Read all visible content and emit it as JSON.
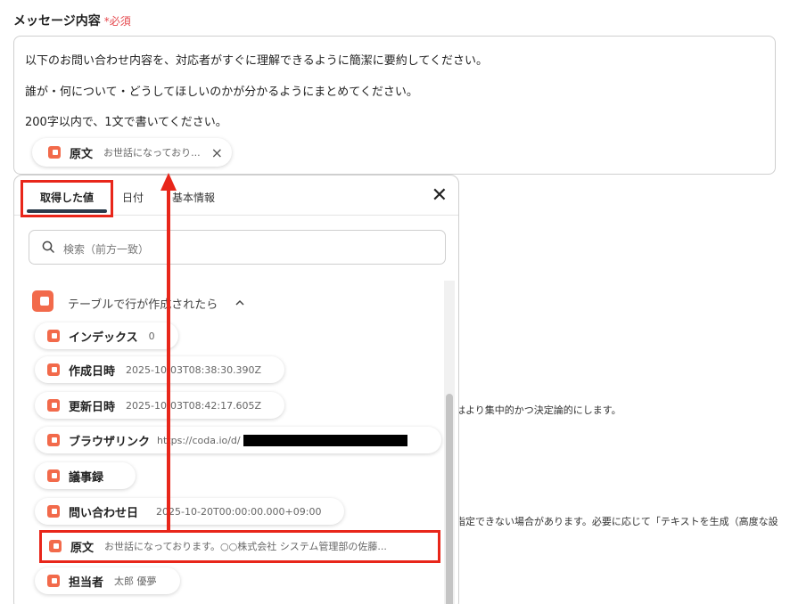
{
  "field": {
    "label": "メッセージ内容",
    "required_mark": "*",
    "required_text": "必須"
  },
  "textarea": {
    "lines": [
      "以下のお問い合わせ内容を、対応者がすぐに理解できるように簡潔に要約してください。",
      "誰が・何について・どうしてほしいのかが分かるようにまとめてください。",
      "200字以内で、1文で書いてください。"
    ],
    "chip": {
      "title": "原文",
      "value": "お世話になっており...",
      "remove": "×"
    }
  },
  "background_text": {
    "line1": "はより集中的かつ決定論的にします。",
    "line2": "指定できない場合があります。必要に応じて「テキストを生成（高度な設"
  },
  "popup": {
    "tabs": [
      {
        "label": "取得した値"
      },
      {
        "label": "日付"
      },
      {
        "label": "基本情報"
      }
    ],
    "close": "✕",
    "search_placeholder": "検索（前方一致）",
    "section_title": "テーブルで行が作成されたら",
    "items": [
      {
        "title": "インデックス",
        "value": "0"
      },
      {
        "title": "作成日時",
        "value": "2025-10-03T08:38:30.390Z"
      },
      {
        "title": "更新日時",
        "value": "2025-10-03T08:42:17.605Z"
      },
      {
        "title": "ブラウザリンク",
        "value": "https://coda.io/d/"
      },
      {
        "title": "議事録",
        "value": ""
      },
      {
        "title": "問い合わせ日",
        "value": "2025-10-20T00:00:00.000+09:00"
      },
      {
        "title": "原文",
        "value": "お世話になっております。○○株式会社 システム管理部の佐藤..."
      },
      {
        "title": "担当者",
        "value": "太郎 優夢"
      }
    ]
  },
  "colors": {
    "accent": "#f26a4b",
    "highlight": "#e8261a",
    "required": "#e5484d"
  },
  "icons": [
    "coda-icon",
    "search-icon",
    "chevron-up-icon",
    "close-icon",
    "redaction-bar"
  ]
}
